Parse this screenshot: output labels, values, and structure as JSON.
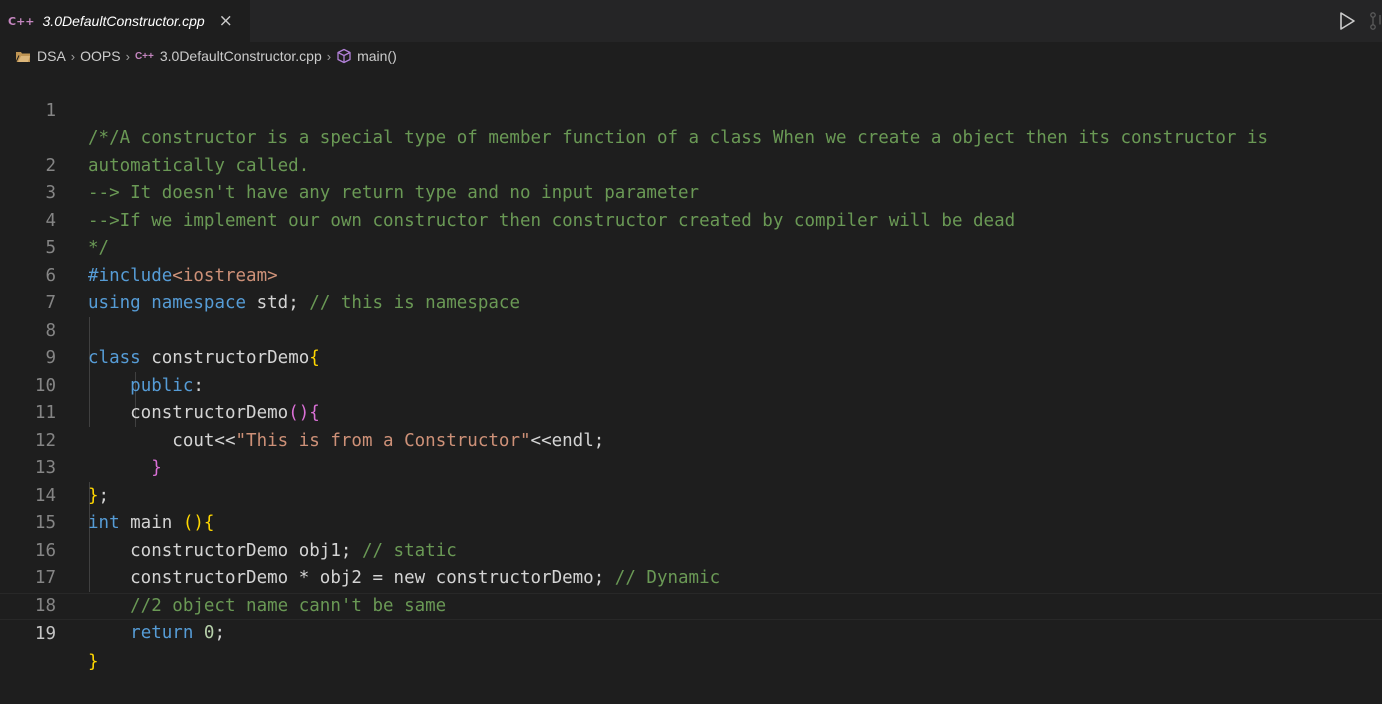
{
  "tab": {
    "icon_text": "C++",
    "title": "3.0DefaultConstructor.cpp",
    "close": "×"
  },
  "breadcrumb": {
    "items": [
      "DSA",
      "OOPS",
      "3.0DefaultConstructor.cpp",
      "main()"
    ],
    "separator": "›",
    "cpp_icon_text": "C++"
  },
  "editor": {
    "active_line": 19,
    "lines": [
      {
        "n": "1",
        "text": "/*/A constructor is a special type of member function of a class When we create a object then its constructor is"
      },
      {
        "n": "",
        "text": "automatically called."
      },
      {
        "n": "2",
        "text": "--> It doesn't have any return type and no input parameter"
      },
      {
        "n": "3",
        "text": "-->If we implement our own constructor then constructor created by compiler will be dead"
      },
      {
        "n": "4",
        "text": "*/"
      },
      {
        "n": "5",
        "text": "#include<iostream>"
      },
      {
        "n": "6",
        "text": "using namespace std; // this is namespace"
      },
      {
        "n": "7",
        "text": ""
      },
      {
        "n": "8",
        "text": "class constructorDemo{"
      },
      {
        "n": "9",
        "text": "    public:"
      },
      {
        "n": "10",
        "text": "    constructorDemo(){"
      },
      {
        "n": "11",
        "text": "        cout<<\"This is from a Constructor\"<<endl;"
      },
      {
        "n": "12",
        "text": "      }"
      },
      {
        "n": "13",
        "text": "};"
      },
      {
        "n": "14",
        "text": "int main (){"
      },
      {
        "n": "15",
        "text": "    constructorDemo obj1; // static"
      },
      {
        "n": "16",
        "text": "    constructorDemo * obj2 = new constructorDemo; // Dynamic"
      },
      {
        "n": "17",
        "text": "    //2 object name cann't be same"
      },
      {
        "n": "18",
        "text": "    return 0;"
      },
      {
        "n": "19",
        "text": "}"
      }
    ]
  },
  "colors": {
    "comment": "#6a9955",
    "keyword": "#569cd6",
    "string": "#ce9178",
    "number": "#b5cea8",
    "bracket_level1": "#ffd700",
    "bracket_level2": "#da70d6",
    "background": "#1e1e1e"
  }
}
